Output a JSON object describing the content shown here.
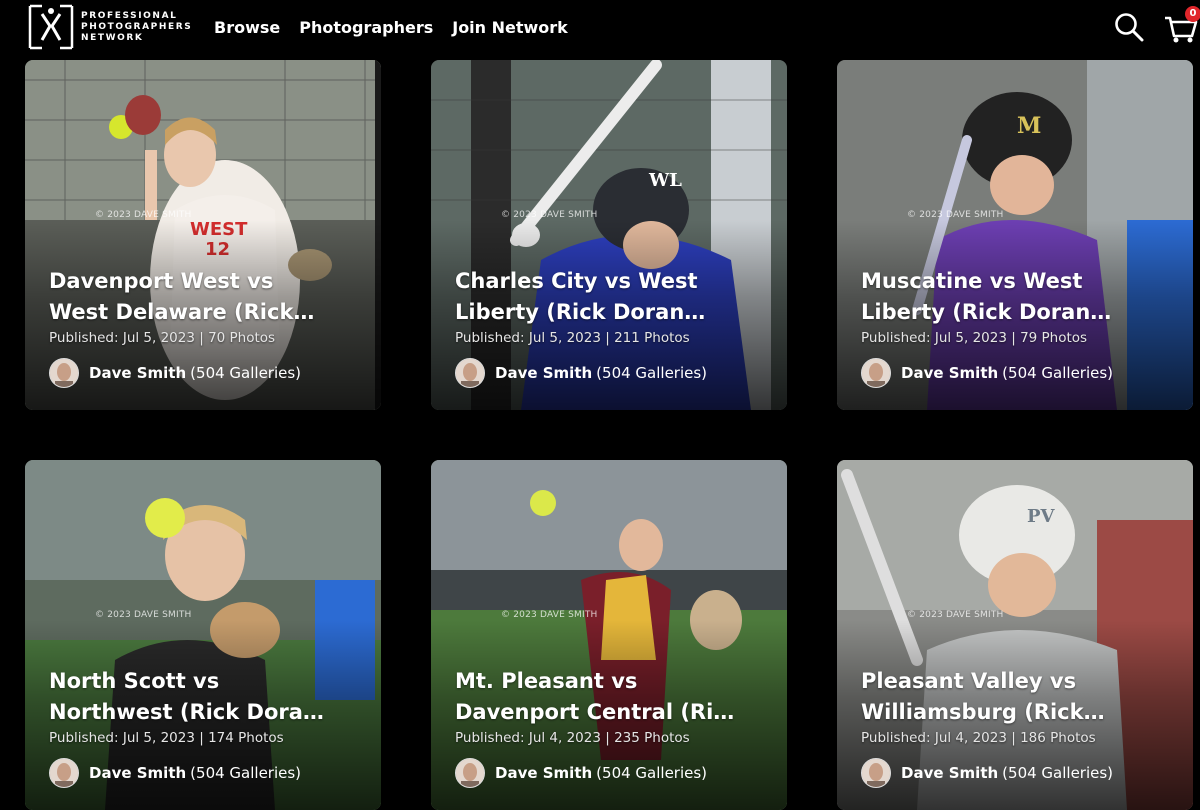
{
  "brand": {
    "line1": "PROFESSIONAL",
    "line2": "PHOTOGRAPHERS",
    "line3": "NETWORK"
  },
  "nav": {
    "browse": "Browse",
    "photographers": "Photographers",
    "join": "Join Network"
  },
  "cart": {
    "count": "0"
  },
  "galleries": [
    {
      "title": "Davenport West vs West Delaware (Rick Doran Classic)",
      "meta": "Published: Jul 5, 2023 | 70 Photos",
      "watermark": "© 2023 DAVE SMITH",
      "author": "Dave Smith",
      "author_count": "(504 Galleries)"
    },
    {
      "title": "Charles City vs West Liberty (Rick Doran Classic)",
      "meta": "Published: Jul 5, 2023 | 211 Photos",
      "watermark": "© 2023 DAVE SMITH",
      "author": "Dave Smith",
      "author_count": "(504 Galleries)"
    },
    {
      "title": "Muscatine vs West Liberty (Rick Doran Classic)",
      "meta": "Published: Jul 5, 2023 | 79 Photos",
      "watermark": "© 2023 DAVE SMITH",
      "author": "Dave Smith",
      "author_count": "(504 Galleries)"
    },
    {
      "title": "North Scott vs Northwest (Rick Doran Classic)",
      "meta": "Published: Jul 5, 2023 | 174 Photos",
      "watermark": "© 2023 DAVE SMITH",
      "author": "Dave Smith",
      "author_count": "(504 Galleries)"
    },
    {
      "title": "Mt. Pleasant vs Davenport Central (Rick Doran Classic)",
      "meta": "Published: Jul 4, 2023 | 235 Photos",
      "watermark": "© 2023 DAVE SMITH",
      "author": "Dave Smith",
      "author_count": "(504 Galleries)"
    },
    {
      "title": "Pleasant Valley vs Williamsburg (Rick Doran Classic)",
      "meta": "Published: Jul 4, 2023 | 186 Photos",
      "watermark": "© 2023 DAVE SMITH",
      "author": "Dave Smith",
      "author_count": "(504 Galleries)"
    }
  ]
}
